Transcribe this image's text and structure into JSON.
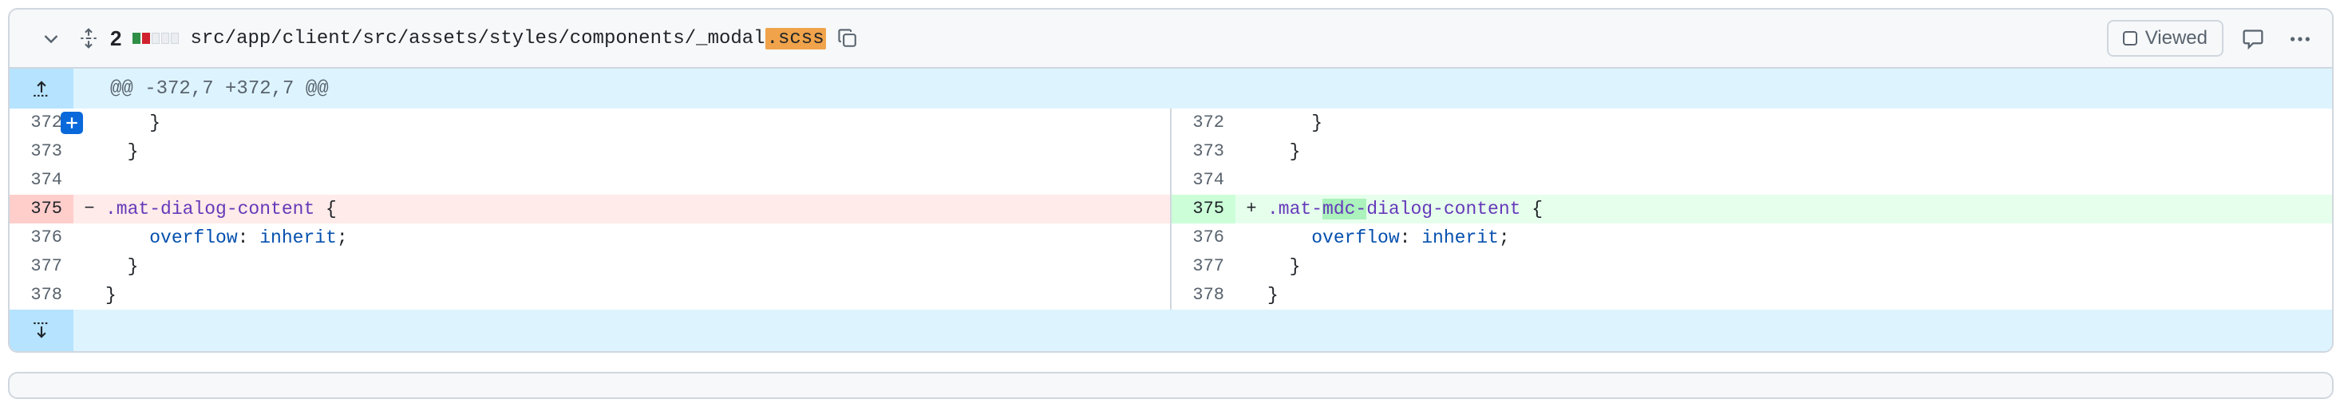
{
  "file": {
    "change_count": "2",
    "path_prefix": "src/app/client/src/assets/styles/components/_modal",
    "path_ext": ".scss",
    "viewed_label": "Viewed"
  },
  "hunk": {
    "header": "@@ -372,7 +372,7 @@"
  },
  "lines": [
    {
      "left_no": "372",
      "right_no": "372",
      "left_code": "    }",
      "right_code": "    }",
      "type": "context"
    },
    {
      "left_no": "373",
      "right_no": "373",
      "left_code": "  }",
      "right_code": "  }",
      "type": "context"
    },
    {
      "left_no": "374",
      "right_no": "374",
      "left_code": "",
      "right_code": "",
      "type": "context"
    },
    {
      "left_no": "375",
      "right_no": "375",
      "left_marker": "−",
      "right_marker": "+",
      "type": "change"
    },
    {
      "left_no": "376",
      "right_no": "376",
      "left_code_prop": "overflow",
      "left_code_val": "inherit",
      "type": "context"
    },
    {
      "left_no": "377",
      "right_no": "377",
      "left_code": "  }",
      "right_code": "  }",
      "type": "context"
    },
    {
      "left_no": "378",
      "right_no": "378",
      "left_code": "}",
      "right_code": "}",
      "type": "context"
    }
  ],
  "change": {
    "left_selector": ".mat-dialog-content",
    "right_selector_a": ".mat-",
    "right_selector_added": "mdc-",
    "right_selector_b": "dialog-content",
    "brace": " {"
  },
  "icons": {
    "collapse": "chevron-down-icon",
    "expand": "unfold-icon",
    "copy": "copy-icon",
    "comment": "comment-icon",
    "more": "kebab-horizontal-icon",
    "expand_up": "fold-up-icon",
    "expand_down": "fold-down-icon",
    "add_comment": "plus-icon"
  },
  "colors": {
    "deletion_bg": "#ffebe9",
    "addition_bg": "#e6ffec",
    "hunk_bg": "#ddf4ff",
    "ext_highlight": "#f0a34a"
  }
}
